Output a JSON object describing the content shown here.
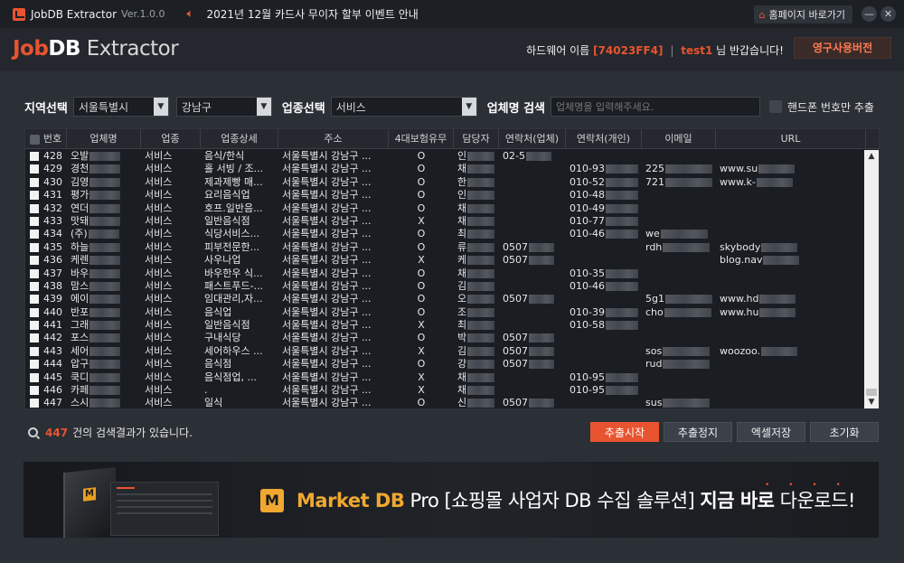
{
  "window": {
    "title": "JobDB Extractor",
    "version": "Ver.1.0.0",
    "notice": "2021년 12월 카드사 무이자 할부 이벤트 안내",
    "home_button": "홈페이지 바로가기",
    "minimize_glyph": "—",
    "close_glyph": "✕"
  },
  "header": {
    "brand_part1": "Job",
    "brand_part2": "DB",
    "brand_part3": " Extractor",
    "hardware_label": "하드웨어 이름",
    "hardware_id": "[74023FF4]",
    "separator": "|",
    "user": "test1",
    "welcome": " 님 반갑습니다!",
    "permanent_button": "영구사용버전"
  },
  "filters": {
    "region_label": "지역선택",
    "city": "서울특별시",
    "district": "강남구",
    "industry_label": "업종선택",
    "industry": "서비스",
    "company_search_label": "업체명 검색",
    "company_search_placeholder": "업체명을 입력해주세요.",
    "mobile_only_label": "핸드폰 번호만 추출"
  },
  "table": {
    "columns": [
      "번호",
      "업체명",
      "업종",
      "업종상세",
      "주소",
      "4대보험유무",
      "담당자",
      "연락처(업체)",
      "연락처(개인)",
      "이메일",
      "URL"
    ],
    "rows": [
      {
        "no": "428",
        "name": "오발",
        "type": "서비스",
        "detail": "음식/한식",
        "addr": "서울특별시 강남구 ...",
        "ins": "O",
        "mgr": "인",
        "tel": "02-5",
        "cell": "",
        "email": "",
        "url": ""
      },
      {
        "no": "429",
        "name": "경천",
        "type": "서비스",
        "detail": "홀 서빙 / 조...",
        "addr": "서울특별시 강남구 ...",
        "ins": "O",
        "mgr": "채",
        "tel": "",
        "cell": "010-93",
        "email": "225",
        "url": "www.su"
      },
      {
        "no": "430",
        "name": "김영",
        "type": "서비스",
        "detail": "제과제빵 매...",
        "addr": "서울특별시 강남구 ...",
        "ins": "O",
        "mgr": "한",
        "tel": "",
        "cell": "010-52",
        "email": "721",
        "url": "www.k-"
      },
      {
        "no": "431",
        "name": "평가",
        "type": "서비스",
        "detail": "요리음식업",
        "addr": "서울특별시 강남구 ...",
        "ins": "O",
        "mgr": "인",
        "tel": "",
        "cell": "010-48",
        "email": "",
        "url": ""
      },
      {
        "no": "432",
        "name": "연더",
        "type": "서비스",
        "detail": "호프.일반음...",
        "addr": "서울특별시 강남구 ...",
        "ins": "O",
        "mgr": "채",
        "tel": "",
        "cell": "010-49",
        "email": "",
        "url": ""
      },
      {
        "no": "433",
        "name": "맛돼",
        "type": "서비스",
        "detail": "일반음식점",
        "addr": "서울특별시 강남구 ...",
        "ins": "X",
        "mgr": "채",
        "tel": "",
        "cell": "010-77",
        "email": "",
        "url": ""
      },
      {
        "no": "434",
        "name": "(주)",
        "type": "서비스",
        "detail": "식당서비스...",
        "addr": "서울특별시 강남구 ...",
        "ins": "O",
        "mgr": "최",
        "tel": "",
        "cell": "010-46",
        "email": "we",
        "url": ""
      },
      {
        "no": "435",
        "name": "하늘",
        "type": "서비스",
        "detail": "피부전문한...",
        "addr": "서울특별시 강남구 ...",
        "ins": "O",
        "mgr": "류",
        "tel": "0507",
        "cell": "",
        "email": "rdh",
        "url": "skybody"
      },
      {
        "no": "436",
        "name": "케렌",
        "type": "서비스",
        "detail": "사우나업",
        "addr": "서울특별시 강남구 ...",
        "ins": "X",
        "mgr": "케",
        "tel": "0507",
        "cell": "",
        "email": "",
        "url": "blog.nav"
      },
      {
        "no": "437",
        "name": "바우",
        "type": "서비스",
        "detail": "바우한우 식...",
        "addr": "서울특별시 강남구 ...",
        "ins": "O",
        "mgr": "채",
        "tel": "",
        "cell": "010-35",
        "email": "",
        "url": ""
      },
      {
        "no": "438",
        "name": "맘스",
        "type": "서비스",
        "detail": "패스트푸드-...",
        "addr": "서울특별시 강남구 ...",
        "ins": "O",
        "mgr": "김",
        "tel": "",
        "cell": "010-46",
        "email": "",
        "url": ""
      },
      {
        "no": "439",
        "name": "에이",
        "type": "서비스",
        "detail": "임대관리,자...",
        "addr": "서울특별시 강남구 ...",
        "ins": "O",
        "mgr": "오",
        "tel": "0507",
        "cell": "",
        "email": "5g1",
        "url": "www.hd"
      },
      {
        "no": "440",
        "name": "반포",
        "type": "서비스",
        "detail": "음식업",
        "addr": "서울특별시 강남구 ...",
        "ins": "O",
        "mgr": "조",
        "tel": "",
        "cell": "010-39",
        "email": "cho",
        "url": "www.hu"
      },
      {
        "no": "441",
        "name": "그래",
        "type": "서비스",
        "detail": "일반음식점",
        "addr": "서울특별시 강남구 ...",
        "ins": "X",
        "mgr": "최",
        "tel": "",
        "cell": "010-58",
        "email": "",
        "url": ""
      },
      {
        "no": "442",
        "name": "포스",
        "type": "서비스",
        "detail": "구내식당",
        "addr": "서울특별시 강남구 ...",
        "ins": "O",
        "mgr": "박",
        "tel": "0507",
        "cell": "",
        "email": "",
        "url": ""
      },
      {
        "no": "443",
        "name": "세어",
        "type": "서비스",
        "detail": "세어하우스 ...",
        "addr": "서울특별시 강남구 ...",
        "ins": "X",
        "mgr": "김",
        "tel": "0507",
        "cell": "",
        "email": "sos",
        "url": "woozoo."
      },
      {
        "no": "444",
        "name": "압구",
        "type": "서비스",
        "detail": "음식점",
        "addr": "서울특별시 강남구 ...",
        "ins": "O",
        "mgr": "강",
        "tel": "0507",
        "cell": "",
        "email": "rud",
        "url": ""
      },
      {
        "no": "445",
        "name": "쿡디",
        "type": "서비스",
        "detail": "음식점업, ...",
        "addr": "서울특별시 강남구 ...",
        "ins": "X",
        "mgr": "채",
        "tel": "",
        "cell": "010-95",
        "email": "",
        "url": ""
      },
      {
        "no": "446",
        "name": "카페",
        "type": "서비스",
        "detail": ".",
        "addr": "서울특별시 강남구 ...",
        "ins": "X",
        "mgr": "채",
        "tel": "",
        "cell": "010-95",
        "email": "",
        "url": ""
      },
      {
        "no": "447",
        "name": "스시",
        "type": "서비스",
        "detail": "일식",
        "addr": "서울특별시 강남구 ...",
        "ins": "O",
        "mgr": "신",
        "tel": "0507",
        "cell": "",
        "email": "sus",
        "url": ""
      }
    ]
  },
  "footer": {
    "result_count": "447",
    "result_text": "건의 검색결과가 있습니다.",
    "start_button": "추출시작",
    "stop_button": "추출정지",
    "excel_button": "엑셀저장",
    "reset_button": "초기화"
  },
  "banner": {
    "logo_letter": "M",
    "brand_name": "Market DB",
    "brand_suffix": " Pro",
    "tagline": " [쇼핑몰 사업자 DB 수집 솔루션] ",
    "cta_bold": "지금 바로",
    "cta_rest": " 다운로드!",
    "dots": "• • • •"
  },
  "colors": {
    "accent": "#e8542f",
    "background": "#2b2f36",
    "table_bg": "#1a1d22",
    "banner_gold": "#f0a830"
  },
  "icons": [
    "app-logo-icon",
    "speaker-icon",
    "home-icon",
    "search-magnifier-icon",
    "scroll-up-icon",
    "scroll-down-icon"
  ]
}
